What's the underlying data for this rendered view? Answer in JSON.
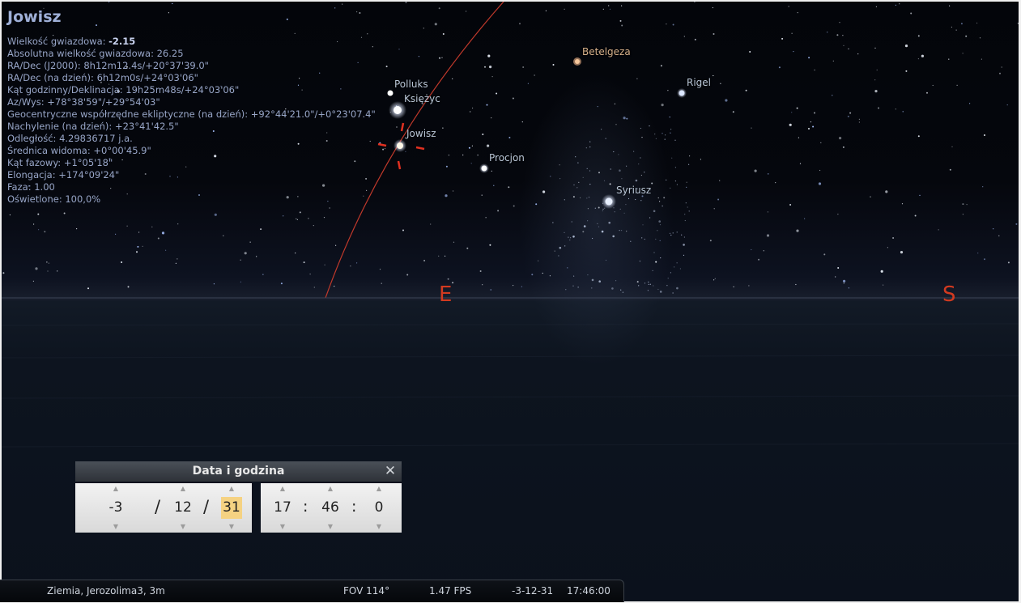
{
  "object_info": {
    "name": "Jowisz",
    "lines": [
      {
        "label": "Wielkość gwiazdowa: ",
        "value": "-2.15",
        "bold": true
      },
      {
        "label": "Absolutna wielkość gwiazdowa: ",
        "value": "26.25"
      },
      {
        "label": "RA/Dec (J2000): ",
        "value": "8h12m12.4s/+20°37'39.0\""
      },
      {
        "label": "RA/Dec (na dzień): ",
        "value": "6h12m0s/+24°03'06\""
      },
      {
        "label": "Kąt godzinny/Deklinacja: ",
        "value": "19h25m48s/+24°03'06\""
      },
      {
        "label": "Az/Wys: ",
        "value": "+78°38'59\"/+29°54'03\""
      },
      {
        "label": "Geocentryczne współrzędne ekliptyczne (na dzień): ",
        "value": "+92°44'21.0\"/+0°23'07.4\""
      },
      {
        "label": "Nachylenie (na dzień): ",
        "value": "+23°41'42.5\""
      },
      {
        "label": "Odległość: ",
        "value": "4.29836717 j.a."
      },
      {
        "label": "Średnica widoma: ",
        "value": "+0°00'45.9\""
      },
      {
        "label": "Kąt fazowy: ",
        "value": "+1°05'18\""
      },
      {
        "label": "Elongacja: ",
        "value": "+174°09'24\""
      },
      {
        "label": "Faza: ",
        "value": "1.00"
      },
      {
        "label": "Oświetlone: ",
        "value": "100,0%"
      }
    ]
  },
  "sky_labels": {
    "polluks": "Polluks",
    "ksiezyc": "Księżyc",
    "jowisz": "Jowisz",
    "procjon": "Procjon",
    "betelgeza": "Betelgeza",
    "rigel": "Rigel",
    "syriusz": "Syriusz"
  },
  "cardinals": {
    "east": "E",
    "south": "S"
  },
  "datetime_dialog": {
    "title": "Data i godzina",
    "close_glyph": "✕",
    "year": "-3",
    "month": "12",
    "day": "31",
    "hour": "17",
    "minute": "46",
    "second": "0",
    "date_sep": "/",
    "time_sep": ":"
  },
  "status_bar": {
    "location": "Ziemia, Jerozolima3, 3m",
    "fov": "FOV 114°",
    "fps": "1.47 FPS",
    "date": "-3-12-31",
    "time": "17:46:00"
  },
  "colors": {
    "cardinal": "#d23a20",
    "selection_marker": "#e03020",
    "ecliptic_line": "#c0392b",
    "date_highlight": "#f5d282"
  }
}
